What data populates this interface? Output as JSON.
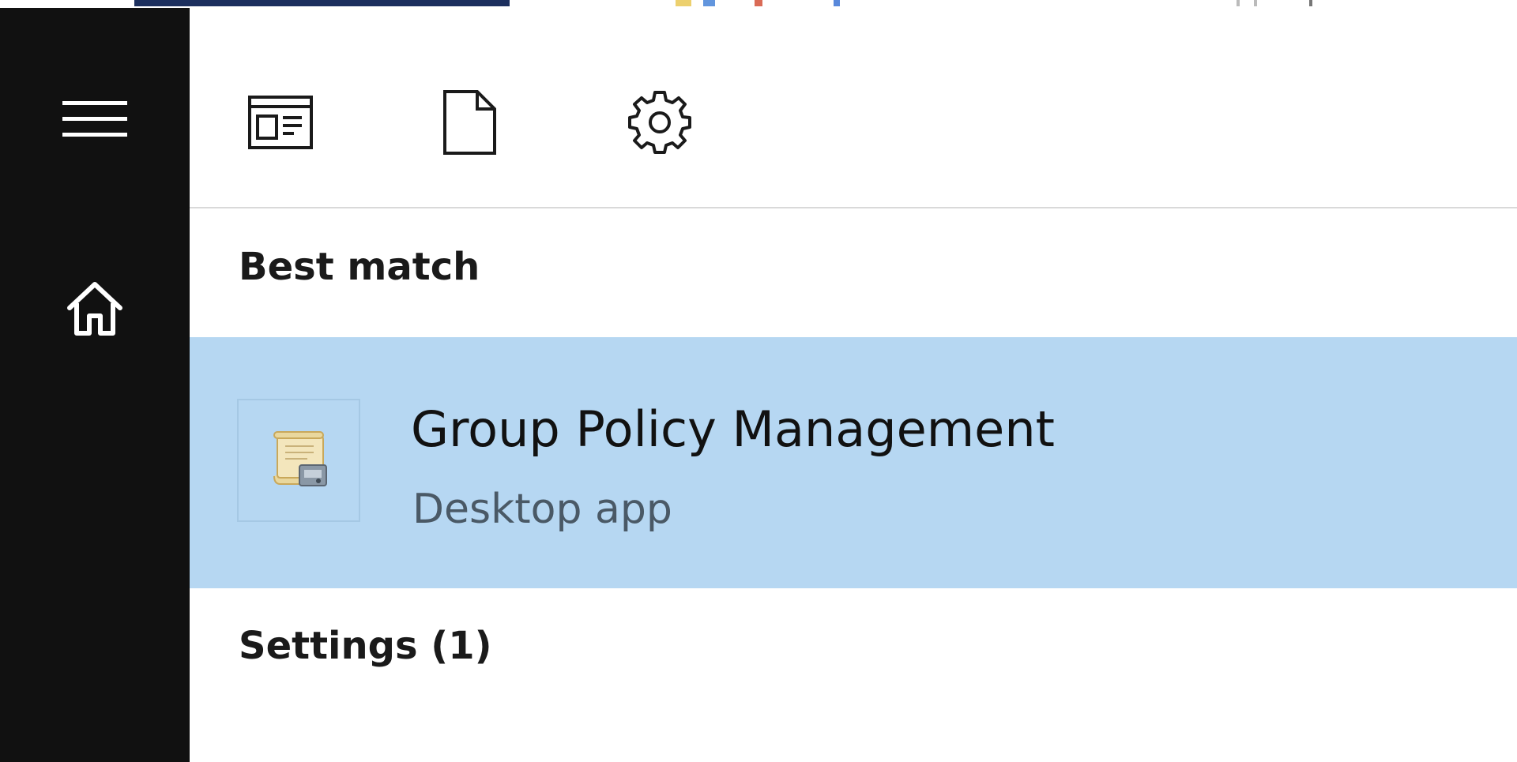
{
  "toolbar": {
    "icons": [
      "apps-icon",
      "document-icon",
      "gear-icon"
    ]
  },
  "sidebar": {
    "icons": [
      "hamburger-menu-icon",
      "home-icon"
    ]
  },
  "sections": {
    "best_match": "Best match",
    "settings": "Settings (1)"
  },
  "result": {
    "title": "Group Policy Management",
    "subtitle": "Desktop app",
    "icon": "group-policy-scroll-icon"
  },
  "colors": {
    "sidebar_bg": "#111111",
    "highlight_bg": "#b6d7f2",
    "divider": "#d9d9d9"
  }
}
